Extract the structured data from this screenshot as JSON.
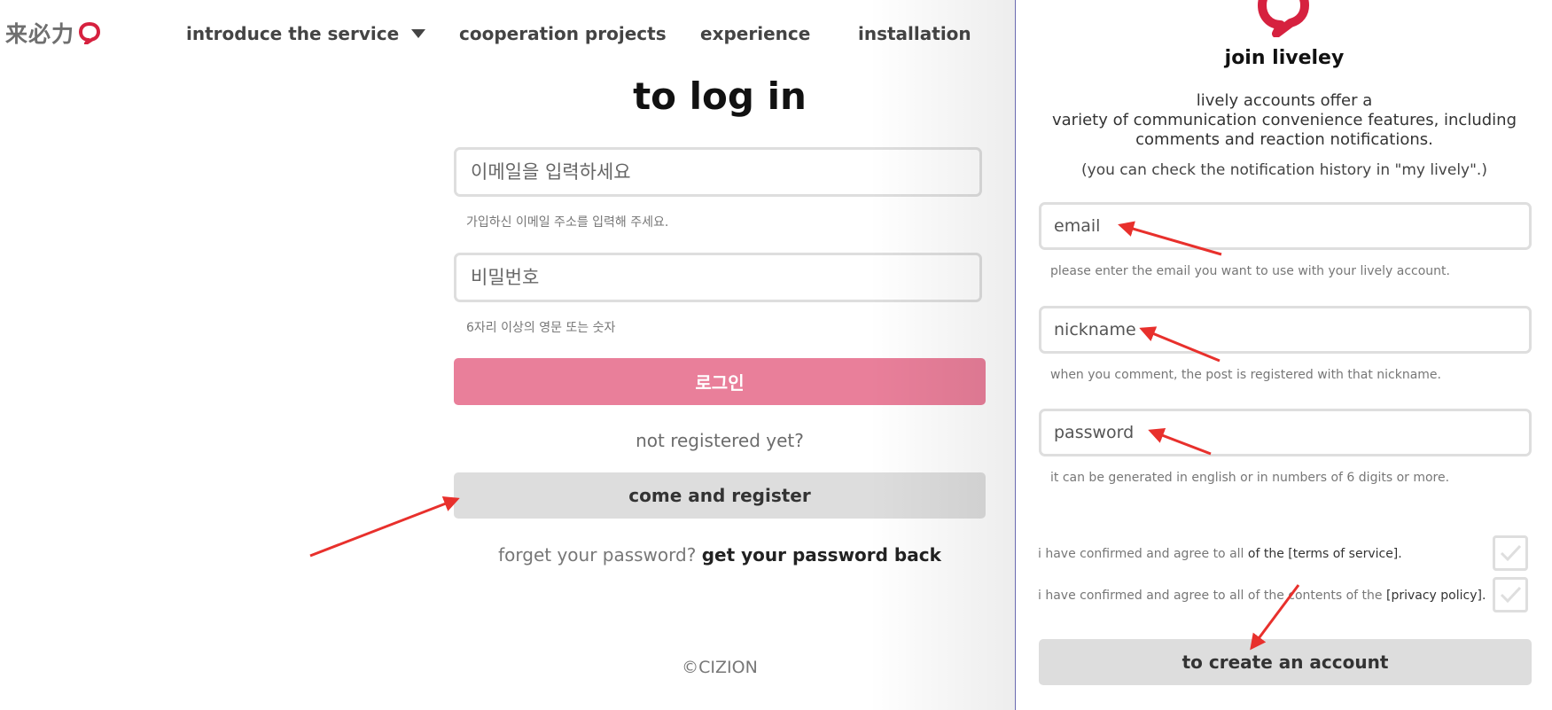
{
  "logo": {
    "text": "来必力"
  },
  "nav": {
    "items": [
      {
        "label": "introduce the service"
      },
      {
        "label": "cooperation projects"
      },
      {
        "label": "experience"
      },
      {
        "label": "installation"
      }
    ]
  },
  "login": {
    "title": "to log in",
    "email_placeholder": "이메일을 입력하세요",
    "email_hint": "가입하신 이메일 주소를 입력해 주세요.",
    "password_placeholder": "비밀번호",
    "password_hint": "6자리 이상의 영문 또는 숫자",
    "login_button": "로그인",
    "not_registered": "not registered yet?",
    "register_button": "come and register",
    "forgot_text": "forget your password?",
    "forgot_link": "get your password back",
    "copyright": "©CIZION"
  },
  "signup": {
    "title": "join liveley",
    "description_line1": "lively accounts offer a",
    "description_line2": "variety of communication convenience features, including",
    "description_line3": "comments and reaction notifications.",
    "note": "(you can check the notification history in \"my lively\".)",
    "email_placeholder": "email",
    "email_hint": "please enter the email you want to use with your lively account.",
    "nickname_placeholder": "nickname",
    "nickname_hint": "when you comment, the post is registered with that nickname.",
    "password_placeholder": "password",
    "password_hint": "it can be generated in english or in numbers of 6 digits or more.",
    "terms_prefix": "i have confirmed and agree to all",
    "terms_link": "of the [terms of service].",
    "privacy_prefix": "i have confirmed and agree to all of the contents of the",
    "privacy_link": "[privacy policy].",
    "create_button": "to create an account"
  },
  "colors": {
    "brand_red": "#d6213f",
    "login_button": "#e97f9a",
    "gray_button": "#dddddd",
    "annotation_arrow": "#e8302c"
  }
}
